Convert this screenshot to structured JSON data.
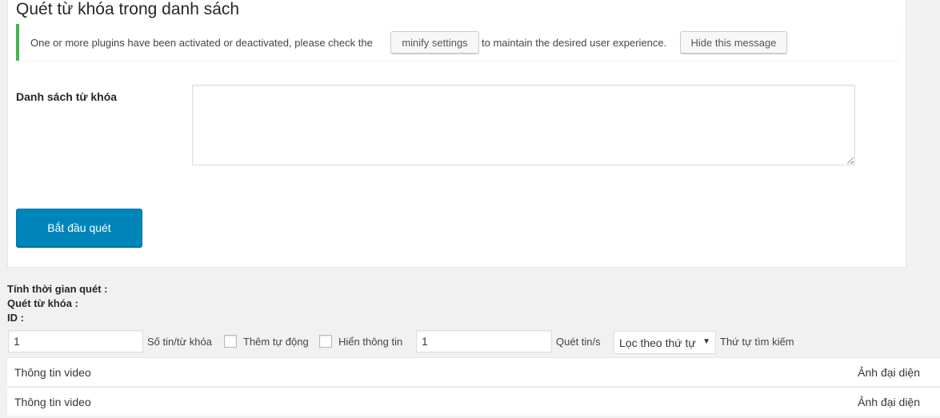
{
  "page": {
    "title": "Quét từ khóa trong danh sách"
  },
  "notice": {
    "text_before": "One or more plugins have been activated or deactivated, please check the",
    "minify_button": "minify settings",
    "text_after": "to maintain the desired user experience.",
    "hide_button": "Hide this message",
    "accent_color": "#46b450"
  },
  "form": {
    "keyword_list_label": "Danh sách từ khóa",
    "keyword_list_value": "",
    "start_button": "Bắt đầu quét",
    "primary_color": "#0085ba"
  },
  "stats": {
    "scan_time_label": "Tính thời gian quét :",
    "keyword_label": "Quét từ khóa :",
    "id_label": "ID :"
  },
  "controls": {
    "per_keyword_value": "1",
    "per_keyword_label": "Số tin/từ khóa",
    "auto_add_label": "Thêm tự động",
    "show_info_label": "Hiển thông tin",
    "rate_value": "1",
    "rate_label": "Quét tin/s",
    "sort_select_value": "Lọc theo thứ tự",
    "search_order_label": "Thứ tự tìm kiếm"
  },
  "table": {
    "rows": [
      {
        "info": "Thông tin video",
        "thumb": "Ảnh đại diện"
      },
      {
        "info": "Thông tin video",
        "thumb": "Ảnh đại diện"
      }
    ]
  }
}
